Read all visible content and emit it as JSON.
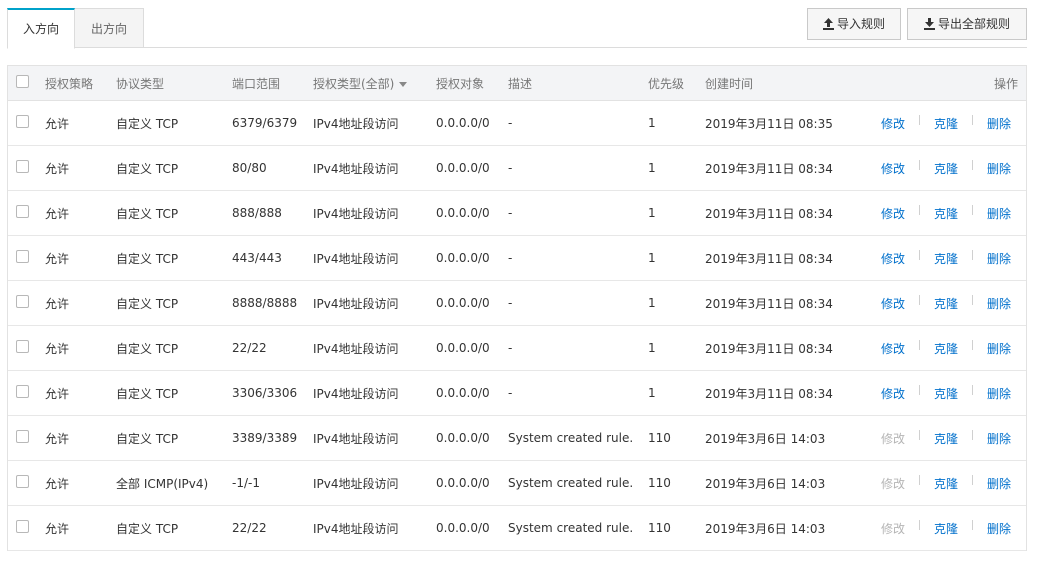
{
  "tabs": [
    {
      "label": "入方向",
      "active": true
    },
    {
      "label": "出方向",
      "active": false
    }
  ],
  "actions": {
    "import_label": "导入规则",
    "export_label": "导出全部规则"
  },
  "table": {
    "headers": {
      "policy": "授权策略",
      "protocol": "协议类型",
      "port": "端口范围",
      "auth_type": "授权类型(全部)",
      "object": "授权对象",
      "desc": "描述",
      "priority": "优先级",
      "created": "创建时间",
      "ops": "操作"
    },
    "op_labels": {
      "edit": "修改",
      "clone": "克隆",
      "delete": "删除"
    },
    "rows": [
      {
        "policy": "允许",
        "protocol": "自定义 TCP",
        "port": "6379/6379",
        "auth_type": "IPv4地址段访问",
        "object": "0.0.0.0/0",
        "desc": "-",
        "priority": "1",
        "created": "2019年3月11日 08:35",
        "edit_enabled": true
      },
      {
        "policy": "允许",
        "protocol": "自定义 TCP",
        "port": "80/80",
        "auth_type": "IPv4地址段访问",
        "object": "0.0.0.0/0",
        "desc": "-",
        "priority": "1",
        "created": "2019年3月11日 08:34",
        "edit_enabled": true
      },
      {
        "policy": "允许",
        "protocol": "自定义 TCP",
        "port": "888/888",
        "auth_type": "IPv4地址段访问",
        "object": "0.0.0.0/0",
        "desc": "-",
        "priority": "1",
        "created": "2019年3月11日 08:34",
        "edit_enabled": true
      },
      {
        "policy": "允许",
        "protocol": "自定义 TCP",
        "port": "443/443",
        "auth_type": "IPv4地址段访问",
        "object": "0.0.0.0/0",
        "desc": "-",
        "priority": "1",
        "created": "2019年3月11日 08:34",
        "edit_enabled": true
      },
      {
        "policy": "允许",
        "protocol": "自定义 TCP",
        "port": "8888/8888",
        "auth_type": "IPv4地址段访问",
        "object": "0.0.0.0/0",
        "desc": "-",
        "priority": "1",
        "created": "2019年3月11日 08:34",
        "edit_enabled": true
      },
      {
        "policy": "允许",
        "protocol": "自定义 TCP",
        "port": "22/22",
        "auth_type": "IPv4地址段访问",
        "object": "0.0.0.0/0",
        "desc": "-",
        "priority": "1",
        "created": "2019年3月11日 08:34",
        "edit_enabled": true
      },
      {
        "policy": "允许",
        "protocol": "自定义 TCP",
        "port": "3306/3306",
        "auth_type": "IPv4地址段访问",
        "object": "0.0.0.0/0",
        "desc": "-",
        "priority": "1",
        "created": "2019年3月11日 08:34",
        "edit_enabled": true
      },
      {
        "policy": "允许",
        "protocol": "自定义 TCP",
        "port": "3389/3389",
        "auth_type": "IPv4地址段访问",
        "object": "0.0.0.0/0",
        "desc": "System created rule.",
        "priority": "110",
        "created": "2019年3月6日 14:03",
        "edit_enabled": false
      },
      {
        "policy": "允许",
        "protocol": "全部 ICMP(IPv4)",
        "port": "-1/-1",
        "auth_type": "IPv4地址段访问",
        "object": "0.0.0.0/0",
        "desc": "System created rule.",
        "priority": "110",
        "created": "2019年3月6日 14:03",
        "edit_enabled": false
      },
      {
        "policy": "允许",
        "protocol": "自定义 TCP",
        "port": "22/22",
        "auth_type": "IPv4地址段访问",
        "object": "0.0.0.0/0",
        "desc": "System created rule.",
        "priority": "110",
        "created": "2019年3月6日 14:03",
        "edit_enabled": false
      }
    ]
  },
  "colors": {
    "link": "#0070cc",
    "disabled": "#b5b5b5",
    "tab_accent": "#00a2ca",
    "header_bg": "#f3f4f6"
  },
  "icons": {
    "import": "upload-icon",
    "export": "download-icon",
    "sort": "caret-down-icon"
  }
}
